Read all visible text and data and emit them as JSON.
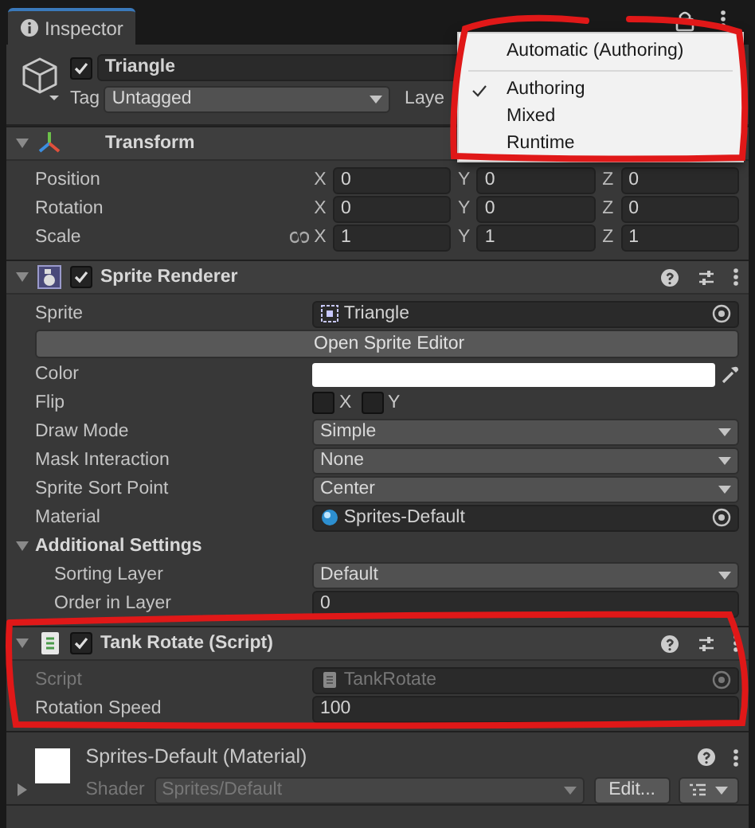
{
  "tab": {
    "label": "Inspector",
    "selected": true
  },
  "object": {
    "enabled": true,
    "name": "Triangle",
    "tag_label": "Tag",
    "tag": "Untagged",
    "layer_label": "Laye"
  },
  "components": [
    {
      "kind": "transform",
      "title": "Transform",
      "expanded": true,
      "rows": [
        {
          "kind": "vector",
          "label": "Position",
          "values": [
            {
              "axis": "X",
              "value": "0"
            },
            {
              "axis": "Y",
              "value": "0"
            },
            {
              "axis": "Z",
              "value": "0"
            }
          ]
        },
        {
          "kind": "vector",
          "label": "Rotation",
          "values": [
            {
              "axis": "X",
              "value": "0"
            },
            {
              "axis": "Y",
              "value": "0"
            },
            {
              "axis": "Z",
              "value": "0"
            }
          ]
        },
        {
          "kind": "vector",
          "label": "Scale",
          "linked": false,
          "values": [
            {
              "axis": "X",
              "value": "1"
            },
            {
              "axis": "Y",
              "value": "1"
            },
            {
              "axis": "Z",
              "value": "1"
            }
          ]
        }
      ]
    },
    {
      "kind": "sprite_renderer",
      "title": "Sprite Renderer",
      "enabled": true,
      "expanded": true,
      "rows": [
        {
          "kind": "sprite",
          "label": "Sprite",
          "value": "Triangle"
        },
        {
          "kind": "button",
          "label": "Open Sprite Editor"
        },
        {
          "kind": "color",
          "label": "Color",
          "color": "#ffffff"
        },
        {
          "kind": "flip",
          "label": "Flip",
          "options": [
            {
              "label": "X",
              "checked": false
            },
            {
              "label": "Y",
              "checked": false
            }
          ]
        },
        {
          "kind": "dropdown",
          "label": "Draw Mode",
          "value": "Simple"
        },
        {
          "kind": "dropdown",
          "label": "Mask Interaction",
          "value": "None"
        },
        {
          "kind": "dropdown",
          "label": "Sprite Sort Point",
          "value": "Center"
        },
        {
          "kind": "material",
          "label": "Material",
          "value": "Sprites-Default"
        },
        {
          "kind": "section",
          "label": "Additional Settings",
          "expanded": true,
          "children": [
            {
              "kind": "dropdown",
              "label": "Sorting Layer",
              "value": "Default"
            },
            {
              "kind": "number",
              "label": "Order in Layer",
              "value": "0"
            }
          ]
        }
      ]
    },
    {
      "kind": "script",
      "title": "Tank Rotate (Script)",
      "enabled": true,
      "expanded": true,
      "rows": [
        {
          "kind": "script",
          "label": "Script",
          "value": "TankRotate",
          "disabled": true
        },
        {
          "kind": "number",
          "label": "Rotation Speed",
          "value": "100"
        }
      ]
    }
  ],
  "material": {
    "title": "Sprites-Default (Material)",
    "shader_label": "Shader",
    "shader": "Sprites/Default",
    "edit_button": "Edit..."
  },
  "menu": {
    "items": [
      {
        "label": "Automatic (Authoring)",
        "checked": false,
        "separator_after": true
      },
      {
        "label": "Authoring",
        "checked": true,
        "separator_after": false
      },
      {
        "label": "Mixed",
        "checked": false,
        "separator_after": false
      },
      {
        "label": "Runtime",
        "checked": false,
        "separator_after": false
      }
    ]
  }
}
